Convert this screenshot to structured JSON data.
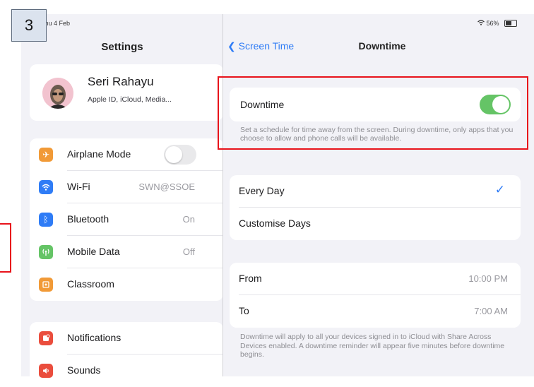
{
  "colors": {
    "accent": "#2f7cf6",
    "toggle_on": "#65c466",
    "highlight": "#e8131b",
    "airplane": "#f19a37",
    "wifi": "#2f7cf6",
    "bluetooth": "#2f7cf6",
    "mobile_data": "#65c466",
    "classroom": "#f19a37",
    "notifications": "#ea4d3d",
    "sounds": "#ea4d3d"
  },
  "step_badge": "3",
  "status_bar": {
    "time_date": "Thu 4 Feb",
    "battery": "56%"
  },
  "sidebar": {
    "title": "Settings",
    "profile": {
      "name": "Seri Rahayu",
      "subtitle": "Apple ID, iCloud, Media..."
    },
    "group1": [
      {
        "label": "Airplane Mode",
        "icon": "airplane-icon",
        "value": "",
        "toggle": "off"
      },
      {
        "label": "Wi-Fi",
        "icon": "wifi-icon",
        "value": "SWN@SSOE"
      },
      {
        "label": "Bluetooth",
        "icon": "bluetooth-icon",
        "value": "On"
      },
      {
        "label": "Mobile Data",
        "icon": "antenna-icon",
        "value": "Off"
      },
      {
        "label": "Classroom",
        "icon": "classroom-icon",
        "value": ""
      }
    ],
    "group2": [
      {
        "label": "Notifications",
        "icon": "notifications-icon"
      },
      {
        "label": "Sounds",
        "icon": "speaker-icon"
      }
    ]
  },
  "detail": {
    "back_label": "Screen Time",
    "title": "Downtime",
    "downtime_label": "Downtime",
    "downtime_enabled": true,
    "downtime_description": "Set a schedule for time away from the screen. During downtime, only apps that you choose to allow and phone calls will be available.",
    "schedule_options": [
      {
        "label": "Every Day",
        "selected": true
      },
      {
        "label": "Customise Days",
        "selected": false
      }
    ],
    "from_label": "From",
    "from_value": "10:00 PM",
    "to_label": "To",
    "to_value": "7:00 AM",
    "footer_note": "Downtime will apply to all your devices signed in to iCloud with Share Across Devices enabled. A downtime reminder will appear five minutes before downtime begins."
  }
}
